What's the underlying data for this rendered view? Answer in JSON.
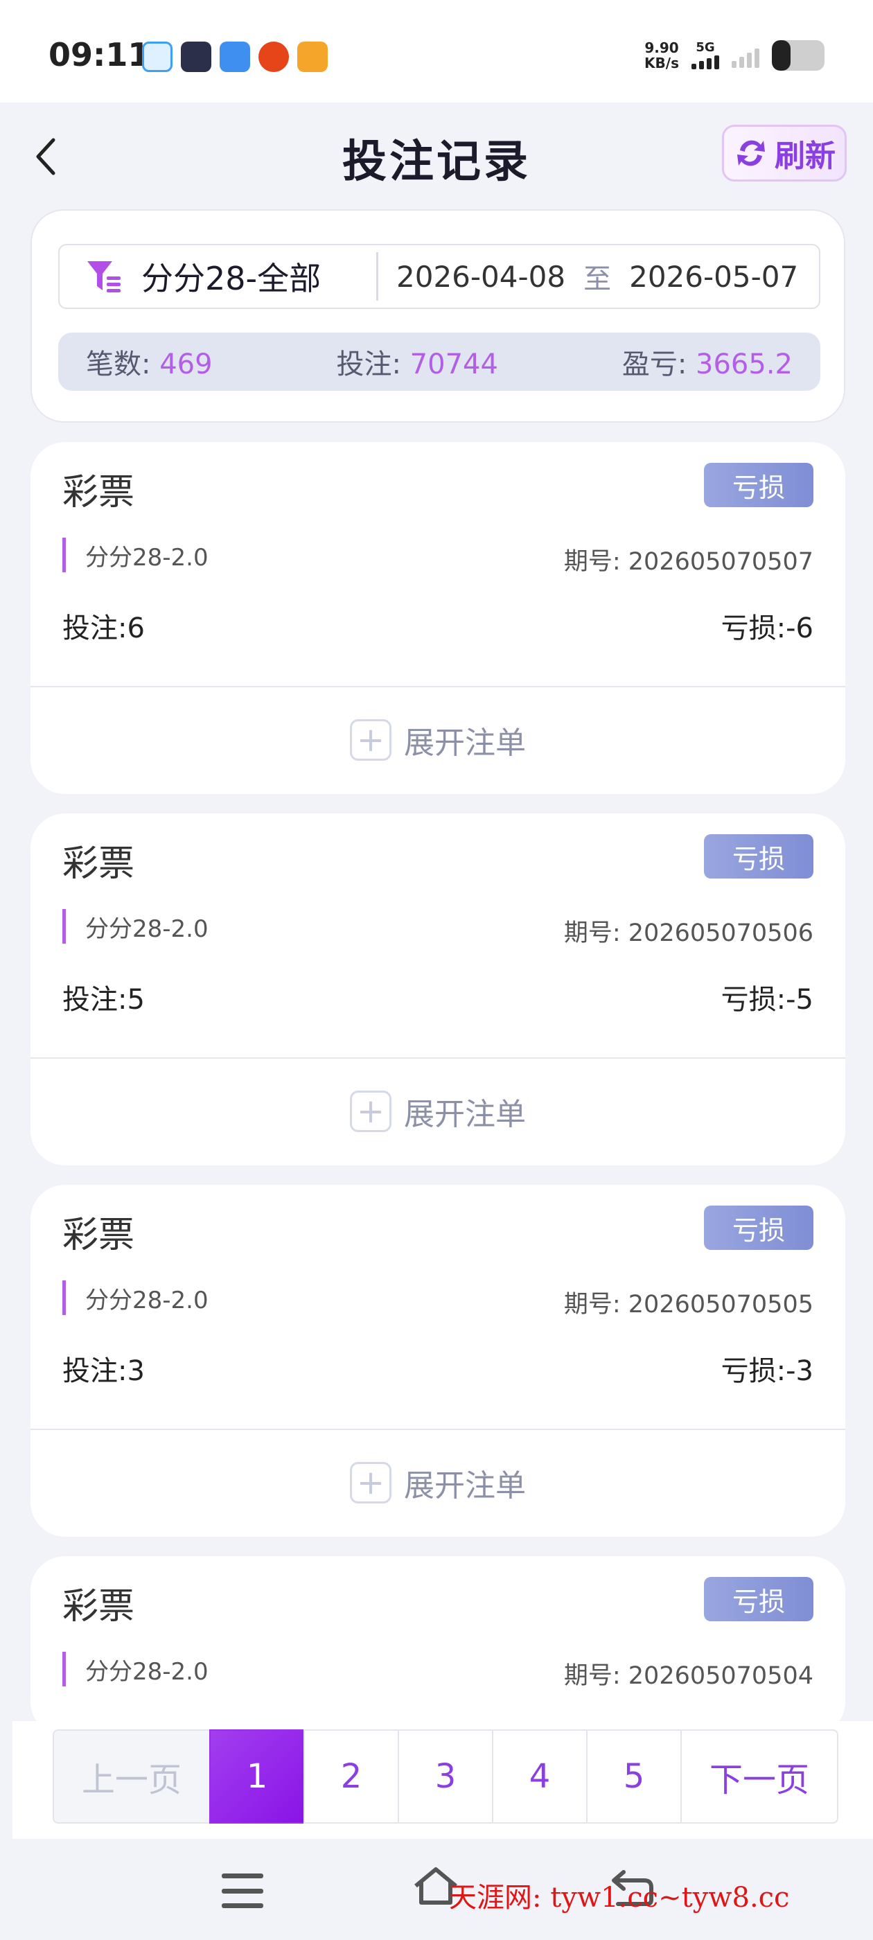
{
  "status_bar": {
    "time": "09:11",
    "net_speed_value": "9.90",
    "net_speed_unit": "KB/s",
    "network": "5G",
    "battery_level": 0.35
  },
  "header": {
    "title": "投注记录",
    "refresh_label": "刷新"
  },
  "filter": {
    "game": "分分28-全部",
    "date_start": "2026-04-08",
    "date_separator": "至",
    "date_end": "2026-05-07"
  },
  "summary": {
    "count_label": "笔数:",
    "count_value": "469",
    "stake_label": "投注:",
    "stake_value": "70744",
    "profit_label": "盈亏:",
    "profit_value": "3665.2"
  },
  "bets": [
    {
      "type": "彩票",
      "status": "亏损",
      "game": "分分28-2.0",
      "issue_label": "期号:",
      "issue": "202605070507",
      "stake_label": "投注:",
      "stake": "6",
      "profit_label": "亏损:",
      "profit": "-6",
      "expand_label": "展开注单"
    },
    {
      "type": "彩票",
      "status": "亏损",
      "game": "分分28-2.0",
      "issue_label": "期号:",
      "issue": "202605070506",
      "stake_label": "投注:",
      "stake": "5",
      "profit_label": "亏损:",
      "profit": "-5",
      "expand_label": "展开注单"
    },
    {
      "type": "彩票",
      "status": "亏损",
      "game": "分分28-2.0",
      "issue_label": "期号:",
      "issue": "202605070505",
      "stake_label": "投注:",
      "stake": "3",
      "profit_label": "亏损:",
      "profit": "-3",
      "expand_label": "展开注单"
    },
    {
      "type": "彩票",
      "status": "亏损",
      "game": "分分28-2.0",
      "issue_label": "期号:",
      "issue": "202605070504"
    }
  ],
  "pagination": {
    "prev_label": "上一页",
    "pages": [
      "1",
      "2",
      "3",
      "4",
      "5"
    ],
    "current": "1",
    "next_label": "下一页"
  },
  "watermark": "天涯网: tyw1.cc~tyw8.cc",
  "colors": {
    "accent": "#8a3fe0",
    "stat_value": "#b25ee6",
    "badge_loss": "#8c9ad8",
    "background": "#f2f3f8"
  }
}
